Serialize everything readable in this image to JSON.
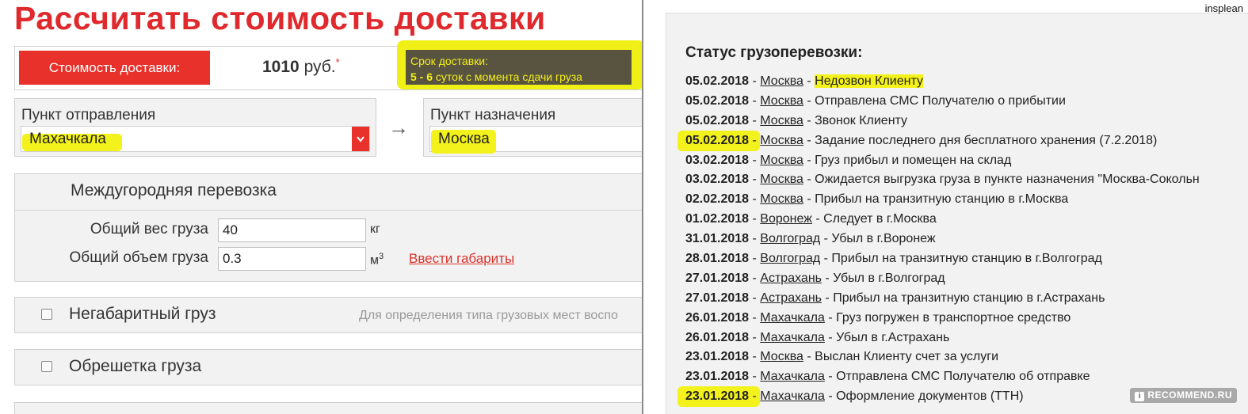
{
  "page_title": "Рассчитать стоимость доставки",
  "cost": {
    "button_label": "Стоимость доставки:",
    "amount": "1010",
    "currency": "руб.",
    "footnote_mark": "*"
  },
  "delivery_term": {
    "label": "Срок доставки:",
    "range": "5 - 6",
    "unit_text": "суток с момента сдачи груза"
  },
  "origin": {
    "label": "Пункт отправления",
    "value": "Махачкала",
    "dropdown_icon": "chevron-down-icon"
  },
  "destination": {
    "label": "Пункт назначения",
    "value": "Москва"
  },
  "route_arrow": "→",
  "intercity": {
    "heading": "Междугородняя перевозка",
    "weight_label": "Общий вес груза",
    "weight_value": "40",
    "weight_unit": "кг",
    "volume_label": "Общий объем груза",
    "volume_value": "0.3",
    "volume_unit": "м",
    "volume_unit_sup": "3",
    "dimensions_link": "Ввести габариты"
  },
  "oversized": {
    "label": "Негабаритный груз",
    "checked": false,
    "hint": "Для определения типа грузовых мест воспо"
  },
  "crating": {
    "label": "Обрешетка груза",
    "checked": false
  },
  "status": {
    "title": "Статус грузоперевозки:",
    "events": [
      {
        "date": "05.02.2018",
        "city": "Москва",
        "text": "Недозвон Клиенту"
      },
      {
        "date": "05.02.2018",
        "city": "Москва",
        "text": "Отправлена СМС Получателю о прибытии"
      },
      {
        "date": "05.02.2018",
        "city": "Москва",
        "text": "Звонок Клиенту"
      },
      {
        "date": "05.02.2018",
        "city": "Москва",
        "text": "Задание последнего дня бесплатного хранения (7.2.2018)"
      },
      {
        "date": "03.02.2018",
        "city": "Москва",
        "text": "Груз прибыл и помещен на склад"
      },
      {
        "date": "03.02.2018",
        "city": "Москва",
        "text": "Ожидается выгрузка груза в пункте назначения \"Москва-Сокольн"
      },
      {
        "date": "02.02.2018",
        "city": "Москва",
        "text": "Прибыл на транзитную станцию в г.Москва"
      },
      {
        "date": "01.02.2018",
        "city": "Воронеж",
        "text": "Следует в г.Москва"
      },
      {
        "date": "31.01.2018",
        "city": "Волгоград",
        "text": "Убыл в г.Воронеж"
      },
      {
        "date": "28.01.2018",
        "city": "Волгоград",
        "text": "Прибыл на транзитную станцию в г.Волгоград"
      },
      {
        "date": "27.01.2018",
        "city": "Астрахань",
        "text": "Убыл в г.Волгоград"
      },
      {
        "date": "27.01.2018",
        "city": "Астрахань",
        "text": "Прибыл на транзитную станцию в г.Астрахань"
      },
      {
        "date": "26.01.2018",
        "city": "Махачкала",
        "text": "Груз погружен в транспортное средство"
      },
      {
        "date": "26.01.2018",
        "city": "Махачкала",
        "text": "Убыл в г.Астрахань"
      },
      {
        "date": "23.01.2018",
        "city": "Москва",
        "text": "Выслан Клиенту счет за услуги"
      },
      {
        "date": "23.01.2018",
        "city": "Махачкала",
        "text": "Отправлена СМС Получателю об отправке"
      },
      {
        "date": "23.01.2018",
        "city": "Махачкала",
        "text": "Оформление документов (ТТН)"
      }
    ],
    "separator": " - "
  },
  "watermark_user": "insplean",
  "watermark_site": "RECOMMEND.RU",
  "highlight_color": "#f3f21c",
  "accent_color": "#e8312a"
}
